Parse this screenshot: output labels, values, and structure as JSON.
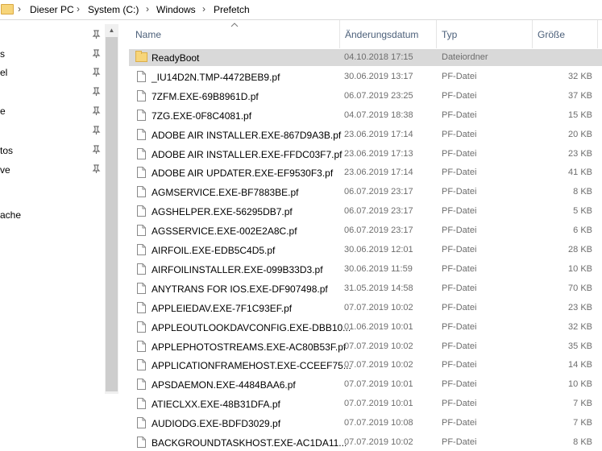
{
  "breadcrumb": {
    "items": [
      "Dieser PC",
      "System (C:)",
      "Windows",
      "Prefetch"
    ],
    "separator": "›"
  },
  "nav": {
    "items": [
      "s",
      "el",
      "",
      "e",
      "",
      "tos",
      "ve",
      "",
      "ache"
    ]
  },
  "columns": {
    "name": "Name",
    "date": "Änderungsdatum",
    "type": "Typ",
    "size": "Größe"
  },
  "files": [
    {
      "name": "ReadyBoot",
      "date": "04.10.2018 17:15",
      "type": "Dateiordner",
      "size": "",
      "kind": "folder"
    },
    {
      "name": "_IU14D2N.TMP-4472BEB9.pf",
      "date": "30.06.2019 13:17",
      "type": "PF-Datei",
      "size": "32 KB",
      "kind": "file"
    },
    {
      "name": "7ZFM.EXE-69B8961D.pf",
      "date": "06.07.2019 23:25",
      "type": "PF-Datei",
      "size": "37 KB",
      "kind": "file"
    },
    {
      "name": "7ZG.EXE-0F8C4081.pf",
      "date": "04.07.2019 18:38",
      "type": "PF-Datei",
      "size": "15 KB",
      "kind": "file"
    },
    {
      "name": "ADOBE AIR INSTALLER.EXE-867D9A3B.pf",
      "date": "23.06.2019 17:14",
      "type": "PF-Datei",
      "size": "20 KB",
      "kind": "file"
    },
    {
      "name": "ADOBE AIR INSTALLER.EXE-FFDC03F7.pf",
      "date": "23.06.2019 17:13",
      "type": "PF-Datei",
      "size": "23 KB",
      "kind": "file"
    },
    {
      "name": "ADOBE AIR UPDATER.EXE-EF9530F3.pf",
      "date": "23.06.2019 17:14",
      "type": "PF-Datei",
      "size": "41 KB",
      "kind": "file"
    },
    {
      "name": "AGMSERVICE.EXE-BF7883BE.pf",
      "date": "06.07.2019 23:17",
      "type": "PF-Datei",
      "size": "8 KB",
      "kind": "file"
    },
    {
      "name": "AGSHELPER.EXE-56295DB7.pf",
      "date": "06.07.2019 23:17",
      "type": "PF-Datei",
      "size": "5 KB",
      "kind": "file"
    },
    {
      "name": "AGSSERVICE.EXE-002E2A8C.pf",
      "date": "06.07.2019 23:17",
      "type": "PF-Datei",
      "size": "6 KB",
      "kind": "file"
    },
    {
      "name": "AIRFOIL.EXE-EDB5C4D5.pf",
      "date": "30.06.2019 12:01",
      "type": "PF-Datei",
      "size": "28 KB",
      "kind": "file"
    },
    {
      "name": "AIRFOILINSTALLER.EXE-099B33D3.pf",
      "date": "30.06.2019 11:59",
      "type": "PF-Datei",
      "size": "10 KB",
      "kind": "file"
    },
    {
      "name": "ANYTRANS FOR IOS.EXE-DF907498.pf",
      "date": "31.05.2019 14:58",
      "type": "PF-Datei",
      "size": "70 KB",
      "kind": "file"
    },
    {
      "name": "APPLEIEDAV.EXE-7F1C93EF.pf",
      "date": "07.07.2019 10:02",
      "type": "PF-Datei",
      "size": "23 KB",
      "kind": "file"
    },
    {
      "name": "APPLEOUTLOOKDAVCONFIG.EXE-DBB10...",
      "date": "01.06.2019 10:01",
      "type": "PF-Datei",
      "size": "32 KB",
      "kind": "file"
    },
    {
      "name": "APPLEPHOTOSTREAMS.EXE-AC80B53F.pf",
      "date": "07.07.2019 10:02",
      "type": "PF-Datei",
      "size": "35 KB",
      "kind": "file"
    },
    {
      "name": "APPLICATIONFRAMEHOST.EXE-CCEEF75...",
      "date": "07.07.2019 10:02",
      "type": "PF-Datei",
      "size": "14 KB",
      "kind": "file"
    },
    {
      "name": "APSDAEMON.EXE-4484BAA6.pf",
      "date": "07.07.2019 10:01",
      "type": "PF-Datei",
      "size": "10 KB",
      "kind": "file"
    },
    {
      "name": "ATIECLXX.EXE-48B31DFA.pf",
      "date": "07.07.2019 10:01",
      "type": "PF-Datei",
      "size": "7 KB",
      "kind": "file"
    },
    {
      "name": "AUDIODG.EXE-BDFD3029.pf",
      "date": "07.07.2019 10:08",
      "type": "PF-Datei",
      "size": "7 KB",
      "kind": "file"
    },
    {
      "name": "BACKGROUNDTASKHOST.EXE-AC1DA11...",
      "date": "07.07.2019 10:02",
      "type": "PF-Datei",
      "size": "8 KB",
      "kind": "file"
    }
  ],
  "selected_index": 0,
  "colors": {
    "selection": "#d9d9d9",
    "header_text": "#4c607a",
    "secondary_text": "#6d6d6d",
    "folder": "#f7d57a"
  }
}
